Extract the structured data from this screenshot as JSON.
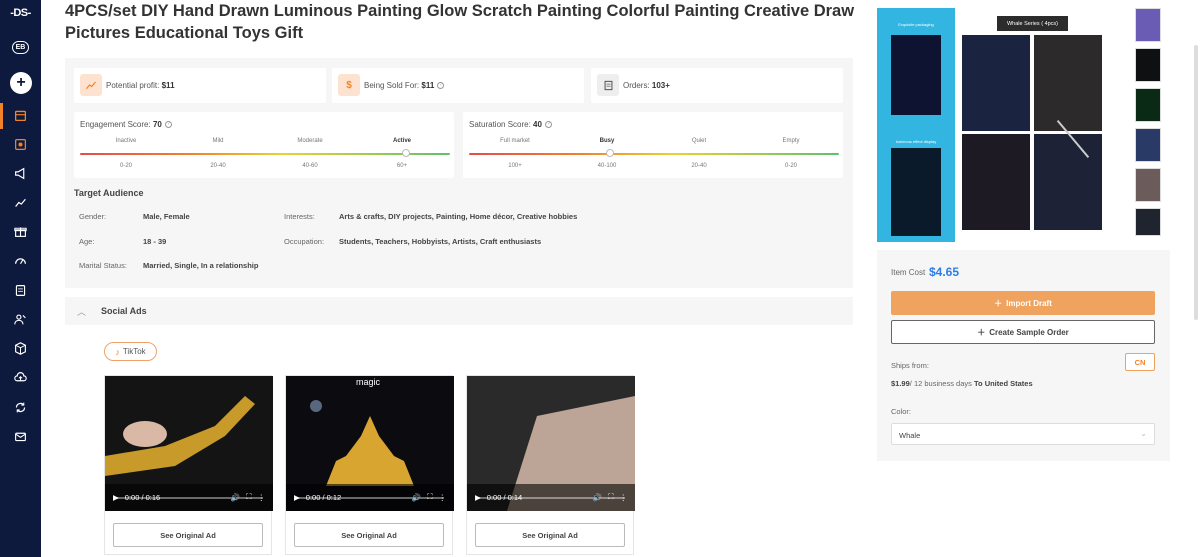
{
  "sidebar": {
    "logo": "-DS-",
    "badge": "EB",
    "add_label": "+",
    "items": [
      "store-icon",
      "product-icon",
      "megaphone-icon",
      "chart-icon",
      "gift-icon",
      "speed-icon",
      "document-icon",
      "users-icon",
      "box-icon",
      "cloud-icon",
      "sync-icon",
      "mail-icon"
    ]
  },
  "product": {
    "title": "4PCS/set DIY Hand Drawn Luminous Painting Glow Scratch Painting Colorful Painting Creative Draw Pictures Educational Toys Gift"
  },
  "stats": {
    "profit_label": "Potential profit:",
    "profit_value": "$11",
    "sold_label": "Being Sold For:",
    "sold_value": "$11",
    "orders_label": "Orders:",
    "orders_value": "103+"
  },
  "engagement": {
    "label": "Engagement Score:",
    "value": "70",
    "levels": [
      "Inactive",
      "Mild",
      "Moderate",
      "Active"
    ],
    "ranges": [
      "0-20",
      "20-40",
      "40-60",
      "60+"
    ],
    "active_index": 3,
    "position": 0.88
  },
  "saturation": {
    "label": "Saturation Score:",
    "value": "40",
    "levels": [
      "Full market",
      "Busy",
      "Quiet",
      "Empty"
    ],
    "ranges": [
      "100+",
      "40-100",
      "20-40",
      "0-20"
    ],
    "active_index": 1,
    "position": 0.38
  },
  "audience": {
    "title": "Target Audience",
    "gender_label": "Gender:",
    "gender": "Male, Female",
    "age_label": "Age:",
    "age": "18 - 39",
    "marital_label": "Marital Status:",
    "marital": "Married, Single, In a relationship",
    "interests_label": "Interests:",
    "interests": "Arts & crafts, DIY projects, Painting, Home décor, Creative hobbies",
    "occupation_label": "Occupation:",
    "occupation": "Students, Teachers, Hobbyists, Artists, Craft enthusiasts"
  },
  "social": {
    "title": "Social Ads",
    "tab": "TikTok",
    "videos": [
      {
        "time": "0:00 / 0:16",
        "button": "See Original Ad"
      },
      {
        "time": "0:00 / 0:12",
        "button": "See Original Ad",
        "overlay": "magic"
      },
      {
        "time": "0:00 / 0:14",
        "button": "See Original Ad"
      }
    ]
  },
  "gallery": {
    "tooltip": "Whale Series ( 4pcs)",
    "side_text_1": "Exquisite packaging",
    "side_text_2": "luminous effect display"
  },
  "purchase": {
    "cost_label": "Item Cost",
    "cost_value": "$4.65",
    "import_label": "Import Draft",
    "sample_label": "Create Sample Order",
    "ships_label": "Ships from:",
    "country": "CN",
    "shipping_price": "$1.99",
    "shipping_days": "/ 12 business days",
    "shipping_to": "To United States",
    "color_label": "Color:",
    "color_value": "Whale"
  },
  "colors": {
    "accent": "#f0822a",
    "sidebar": "#0e1a3d",
    "cost": "#2b7de9"
  }
}
